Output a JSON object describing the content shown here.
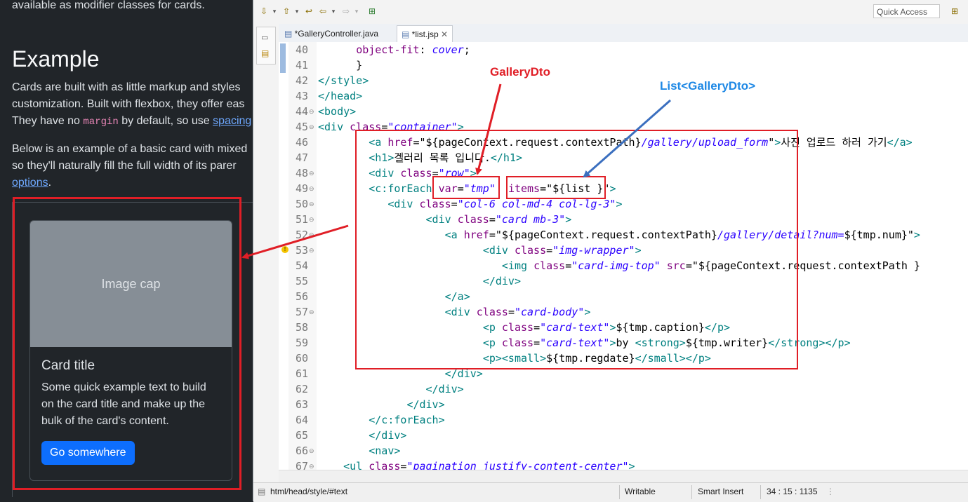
{
  "doc": {
    "intro_tail": "available as modifier classes for cards.",
    "heading": "Example",
    "para1_line1": "Cards are built with as little markup and styles",
    "para1_line2": "customization. Built with flexbox, they offer eas",
    "para1_line3_a": "They have no ",
    "para1_line3_code": "margin",
    "para1_line3_b": " by default, so use ",
    "para1_line3_link": "spacing",
    "para2_line1": "Below is an example of a basic card with mixed",
    "para2_line2": "so they'll naturally fill the full width of its parer",
    "para2_link": "options",
    "para2_end": ".",
    "card": {
      "image_cap": "Image cap",
      "title": "Card title",
      "text": "Some quick example text to build on the card title and make up the bulk of the card's content.",
      "button": "Go somewhere"
    }
  },
  "ide": {
    "quick_access": "Quick Access",
    "tabs": [
      {
        "label": "*GalleryController.java",
        "active": false
      },
      {
        "label": "*list.jsp",
        "active": true
      }
    ],
    "line_numbers": [
      "40",
      "41",
      "42",
      "43",
      "44",
      "45",
      "46",
      "47",
      "48",
      "49",
      "50",
      "51",
      "52",
      "53",
      "54",
      "55",
      "56",
      "57",
      "58",
      "59",
      "60",
      "61",
      "62",
      "63",
      "64",
      "65",
      "66",
      "67"
    ],
    "status": {
      "path": "html/head/style/#text",
      "mode": "Writable",
      "insert": "Smart Insert",
      "position": "34 : 15 : 1135"
    }
  },
  "annotations": {
    "label_item": "GalleryDto",
    "label_list": "List<GalleryDto>",
    "red": "#e01e26",
    "blue": "#1e88e5"
  },
  "colors": {
    "tag": "#008080",
    "attr": "#7f007f",
    "value": "#2a00ff",
    "primary_button": "#0d6efd"
  }
}
